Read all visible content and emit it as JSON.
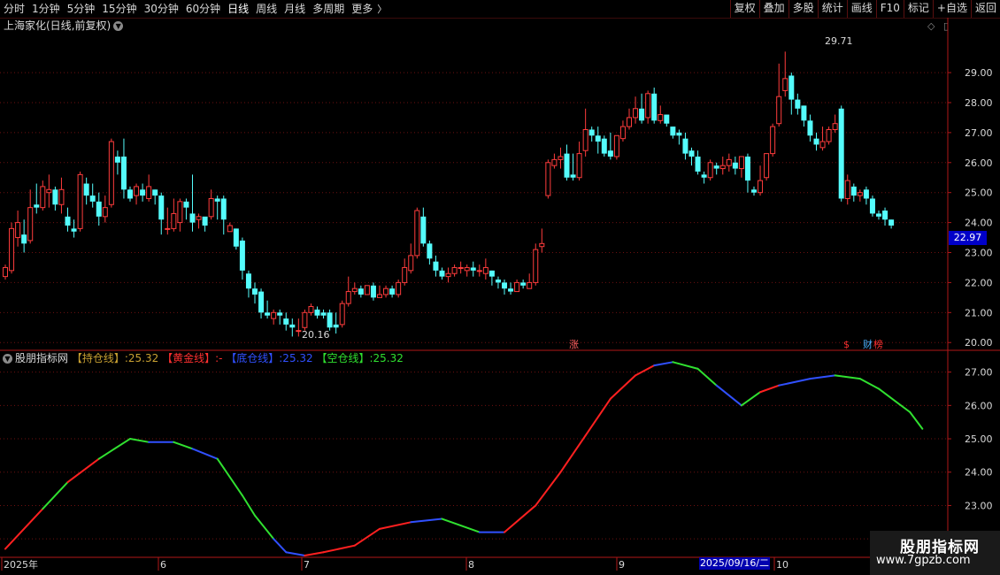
{
  "toolbar": {
    "periods": [
      "分时",
      "1分钟",
      "5分钟",
      "15分钟",
      "30分钟",
      "60分钟",
      "日线",
      "周线",
      "月线",
      "多周期",
      "更多"
    ],
    "active_period": "日线",
    "buttons": [
      "复权",
      "叠加",
      "多股",
      "统计",
      "画线",
      "F10",
      "标记",
      "+自选",
      "返回"
    ]
  },
  "stock": {
    "title": "上海家化(日线,前复权)"
  },
  "price_axis": {
    "labels": [
      "29.00",
      "28.00",
      "27.00",
      "26.00",
      "25.00",
      "24.00",
      "23.00",
      "22.00",
      "21.00",
      "20.00"
    ]
  },
  "indicator": {
    "name": "股朋指标网",
    "items": [
      {
        "label": "【持仓线】",
        "value": "25.32",
        "color": "#c8a032"
      },
      {
        "label": "【黄金线】",
        "value": "-",
        "color": "#ff3030"
      },
      {
        "label": "【底仓线】",
        "value": "25.32",
        "color": "#3050ff"
      },
      {
        "label": "【空仓线】",
        "value": "25.32",
        "color": "#30e030"
      }
    ],
    "axis_labels": [
      "27.00",
      "26.00",
      "25.00",
      "24.00",
      "23.00",
      "22.00"
    ]
  },
  "annotations": {
    "high_label": "29.71",
    "low_label": "20.16",
    "marker_zhang": "涨",
    "marker_s": "$",
    "marker_cai": "财",
    "marker_bang": "榜"
  },
  "cursor": {
    "price": "22.97",
    "date": "2025/09/16/二"
  },
  "date_axis": {
    "labels": [
      "2025年",
      "6",
      "7",
      "8",
      "9",
      "10"
    ]
  },
  "brand": {
    "name": "股朋指标网",
    "url": "www.7gpzb.com"
  },
  "colors": {
    "up": "#ff3c3c",
    "down": "#54fcfc",
    "grid": "#6e1010",
    "axis": "#b01818"
  },
  "chart_data": {
    "type": "candlestick",
    "ylim": [
      19.8,
      30.3
    ],
    "candles": [
      [
        22.2,
        22.5,
        22.1,
        22.6
      ],
      [
        22.4,
        23.8,
        22.3,
        24.0
      ],
      [
        23.5,
        24.0,
        23.2,
        24.4
      ],
      [
        23.6,
        23.3,
        23.0,
        24.1
      ],
      [
        23.4,
        24.5,
        23.3,
        25.1
      ],
      [
        24.6,
        24.5,
        24.3,
        25.3
      ],
      [
        24.5,
        25.2,
        24.4,
        25.4
      ],
      [
        25.0,
        25.1,
        24.5,
        25.6
      ],
      [
        25.1,
        24.6,
        24.4,
        25.2
      ],
      [
        24.6,
        25.1,
        24.3,
        25.5
      ],
      [
        24.2,
        23.9,
        23.7,
        24.5
      ],
      [
        23.8,
        23.7,
        23.5,
        24.1
      ],
      [
        23.8,
        25.6,
        23.7,
        25.7
      ],
      [
        25.3,
        24.9,
        24.6,
        25.5
      ],
      [
        24.9,
        24.7,
        24.5,
        25.3
      ],
      [
        24.7,
        24.2,
        23.9,
        25.0
      ],
      [
        24.2,
        24.5,
        24.0,
        24.9
      ],
      [
        24.6,
        26.7,
        24.5,
        26.8
      ],
      [
        26.2,
        26.0,
        25.6,
        26.4
      ],
      [
        26.2,
        25.1,
        24.8,
        26.8
      ],
      [
        25.1,
        24.8,
        24.7,
        25.2
      ],
      [
        24.9,
        25.2,
        24.6,
        25.3
      ],
      [
        25.1,
        24.9,
        24.7,
        25.3
      ],
      [
        24.8,
        25.2,
        24.7,
        25.6
      ],
      [
        25.1,
        24.9,
        24.6,
        25.1
      ],
      [
        24.9,
        24.1,
        23.6,
        25.0
      ],
      [
        23.8,
        23.8,
        23.6,
        24.5
      ],
      [
        23.8,
        24.3,
        23.7,
        24.8
      ],
      [
        24.0,
        24.7,
        23.7,
        24.8
      ],
      [
        24.7,
        24.5,
        24.1,
        24.8
      ],
      [
        24.3,
        24.0,
        23.7,
        25.6
      ],
      [
        24.1,
        24.2,
        23.8,
        24.3
      ],
      [
        24.2,
        23.9,
        23.7,
        24.1
      ],
      [
        24.2,
        24.8,
        24.1,
        25.1
      ],
      [
        24.8,
        24.7,
        24.1,
        24.9
      ],
      [
        24.8,
        24.1,
        23.6,
        24.9
      ],
      [
        23.7,
        23.9,
        23.7,
        24.0
      ],
      [
        23.8,
        23.2,
        23.1,
        23.8
      ],
      [
        23.4,
        22.4,
        22.1,
        23.5
      ],
      [
        22.3,
        21.8,
        21.5,
        22.4
      ],
      [
        21.8,
        21.6,
        21.3,
        22.0
      ],
      [
        21.7,
        21.0,
        20.8,
        21.8
      ],
      [
        21.0,
        20.9,
        20.8,
        21.4
      ],
      [
        20.8,
        21.0,
        20.6,
        21.1
      ],
      [
        21.0,
        20.9,
        20.6,
        21.1
      ],
      [
        20.8,
        20.6,
        20.4,
        21.0
      ],
      [
        20.6,
        20.5,
        20.2,
        20.8
      ],
      [
        20.4,
        20.4,
        20.2,
        20.8
      ],
      [
        20.5,
        21.0,
        20.4,
        21.1
      ],
      [
        21.0,
        21.2,
        20.9,
        21.3
      ],
      [
        21.1,
        20.9,
        20.8,
        21.2
      ],
      [
        21.0,
        20.9,
        20.8,
        21.1
      ],
      [
        21.0,
        20.5,
        20.4,
        21.1
      ],
      [
        20.6,
        20.5,
        20.3,
        21.0
      ],
      [
        20.6,
        21.3,
        20.5,
        21.4
      ],
      [
        21.3,
        21.7,
        21.2,
        22.2
      ],
      [
        21.7,
        21.8,
        21.6,
        22.0
      ],
      [
        21.8,
        21.6,
        21.5,
        21.9
      ],
      [
        21.6,
        21.9,
        21.6,
        21.9
      ],
      [
        21.9,
        21.5,
        21.4,
        22.0
      ],
      [
        21.5,
        21.6,
        21.5,
        21.9
      ],
      [
        21.6,
        21.8,
        21.5,
        21.9
      ],
      [
        21.8,
        21.6,
        21.5,
        21.9
      ],
      [
        21.6,
        22.0,
        21.5,
        22.1
      ],
      [
        22.0,
        22.5,
        21.9,
        22.8
      ],
      [
        22.4,
        22.9,
        22.3,
        23.3
      ],
      [
        22.9,
        24.4,
        22.8,
        24.5
      ],
      [
        24.2,
        23.3,
        23.2,
        24.5
      ],
      [
        23.3,
        22.8,
        22.6,
        23.4
      ],
      [
        22.7,
        22.4,
        22.2,
        22.9
      ],
      [
        22.4,
        22.2,
        22.1,
        22.5
      ],
      [
        22.2,
        22.3,
        22.0,
        22.5
      ],
      [
        22.3,
        22.5,
        22.2,
        22.6
      ],
      [
        22.5,
        22.5,
        22.3,
        22.7
      ],
      [
        22.4,
        22.5,
        22.2,
        22.6
      ],
      [
        22.5,
        22.4,
        22.2,
        22.7
      ],
      [
        22.4,
        22.4,
        22.2,
        22.6
      ],
      [
        22.3,
        22.5,
        22.1,
        22.8
      ],
      [
        22.4,
        22.2,
        21.9,
        22.4
      ],
      [
        22.1,
        22.0,
        21.8,
        22.2
      ],
      [
        22.0,
        21.8,
        21.6,
        22.1
      ],
      [
        21.8,
        21.7,
        21.6,
        22.0
      ],
      [
        21.7,
        22.0,
        21.7,
        22.1
      ],
      [
        22.0,
        21.9,
        21.8,
        22.1
      ],
      [
        21.8,
        22.0,
        21.8,
        22.3
      ],
      [
        22.0,
        23.1,
        21.9,
        23.3
      ],
      [
        23.2,
        23.3,
        23.0,
        23.8
      ],
      [
        24.9,
        26.0,
        24.8,
        26.1
      ],
      [
        25.9,
        26.1,
        25.8,
        26.3
      ],
      [
        26.1,
        26.2,
        25.8,
        26.5
      ],
      [
        26.3,
        25.5,
        25.4,
        26.6
      ],
      [
        25.6,
        25.5,
        25.4,
        26.3
      ],
      [
        25.5,
        26.3,
        25.4,
        26.7
      ],
      [
        26.4,
        27.1,
        26.2,
        27.8
      ],
      [
        27.1,
        26.9,
        26.7,
        27.2
      ],
      [
        26.9,
        26.7,
        26.3,
        27.2
      ],
      [
        26.8,
        26.3,
        26.2,
        26.9
      ],
      [
        26.4,
        26.2,
        26.1,
        27.0
      ],
      [
        26.2,
        26.9,
        26.1,
        26.9
      ],
      [
        26.8,
        27.2,
        26.7,
        27.4
      ],
      [
        27.2,
        27.5,
        27.1,
        27.8
      ],
      [
        27.5,
        27.8,
        27.3,
        28.2
      ],
      [
        27.8,
        27.4,
        27.3,
        28.3
      ],
      [
        27.5,
        28.3,
        27.3,
        28.4
      ],
      [
        28.3,
        27.4,
        27.3,
        28.5
      ],
      [
        27.4,
        27.6,
        27.3,
        27.9
      ],
      [
        27.6,
        27.3,
        27.2,
        27.6
      ],
      [
        27.2,
        26.9,
        26.8,
        27.2
      ],
      [
        27.0,
        26.9,
        26.6,
        27.1
      ],
      [
        26.8,
        26.3,
        26.1,
        27.0
      ],
      [
        26.4,
        26.2,
        25.9,
        26.5
      ],
      [
        26.2,
        25.7,
        25.6,
        26.4
      ],
      [
        25.6,
        25.5,
        25.3,
        25.7
      ],
      [
        25.5,
        26.0,
        25.4,
        26.1
      ],
      [
        25.9,
        25.8,
        25.6,
        26.0
      ],
      [
        25.8,
        25.9,
        25.6,
        26.2
      ],
      [
        25.9,
        26.1,
        25.7,
        26.3
      ],
      [
        26.0,
        25.8,
        25.6,
        26.2
      ],
      [
        25.8,
        26.2,
        25.5,
        26.2
      ],
      [
        26.2,
        25.4,
        25.0,
        26.3
      ],
      [
        25.1,
        25.0,
        24.9,
        25.2
      ],
      [
        25.0,
        25.4,
        24.9,
        25.9
      ],
      [
        25.5,
        26.3,
        25.4,
        26.3
      ],
      [
        26.3,
        27.2,
        26.2,
        27.3
      ],
      [
        27.3,
        28.2,
        27.2,
        29.3
      ],
      [
        28.4,
        28.8,
        28.2,
        29.7
      ],
      [
        28.9,
        28.1,
        27.6,
        29.0
      ],
      [
        28.1,
        27.8,
        27.6,
        28.3
      ],
      [
        27.9,
        27.4,
        27.2,
        27.9
      ],
      [
        27.4,
        26.9,
        26.7,
        27.6
      ],
      [
        26.8,
        26.6,
        26.4,
        27.0
      ],
      [
        26.5,
        26.7,
        26.4,
        27.2
      ],
      [
        26.7,
        27.1,
        26.6,
        27.2
      ],
      [
        27.1,
        27.3,
        27.0,
        27.6
      ],
      [
        27.8,
        24.8,
        24.7,
        27.9
      ],
      [
        24.8,
        25.4,
        24.6,
        25.6
      ],
      [
        25.2,
        24.9,
        24.7,
        25.3
      ],
      [
        24.9,
        25.0,
        24.7,
        25.1
      ],
      [
        25.1,
        24.8,
        24.6,
        25.2
      ],
      [
        24.8,
        24.3,
        24.2,
        24.9
      ],
      [
        24.3,
        24.2,
        24.1,
        24.4
      ],
      [
        24.4,
        24.1,
        23.9,
        24.5
      ],
      [
        24.1,
        23.9,
        23.8,
        24.1
      ]
    ],
    "indicator_ylim": [
      21.5,
      27.6
    ],
    "indicator_line": {
      "x": [
        0,
        6,
        10,
        15,
        20,
        23,
        27,
        30,
        34,
        38,
        40,
        43,
        45,
        48,
        51,
        56,
        60,
        65,
        70,
        76,
        80,
        85,
        89,
        93,
        97,
        101,
        104,
        107,
        111,
        114,
        118,
        121,
        124,
        129,
        133,
        137,
        140,
        145,
        147
      ],
      "y": [
        21.7,
        22.9,
        23.7,
        24.4,
        25.0,
        24.9,
        24.9,
        24.7,
        24.4,
        23.3,
        22.7,
        22.0,
        21.6,
        21.5,
        21.6,
        21.8,
        22.3,
        22.5,
        22.6,
        22.2,
        22.2,
        23.0,
        24.0,
        25.1,
        26.2,
        26.9,
        27.2,
        27.3,
        27.1,
        26.6,
        26.0,
        26.4,
        26.6,
        26.8,
        26.9,
        26.8,
        26.5,
        25.8,
        25.3
      ],
      "colors": [
        "#ff2020",
        "#30e030",
        "#ff2020",
        "#30e030",
        "#30e030",
        "#3050ff",
        "#30e030",
        "#3050ff",
        "#30e030",
        "#30e030",
        "#30e030",
        "#3050ff",
        "#3050ff",
        "#ff2020",
        "#ff2020",
        "#ff2020",
        "#ff2020",
        "#3050ff",
        "#30e030",
        "#3050ff",
        "#ff2020",
        "#ff2020",
        "#ff2020",
        "#ff2020",
        "#ff2020",
        "#ff2020",
        "#3050ff",
        "#30e030",
        "#30e030",
        "#3050ff",
        "#30e030",
        "#ff2020",
        "#3050ff",
        "#3050ff",
        "#30e030",
        "#30e030",
        "#30e030",
        "#30e030"
      ]
    }
  }
}
